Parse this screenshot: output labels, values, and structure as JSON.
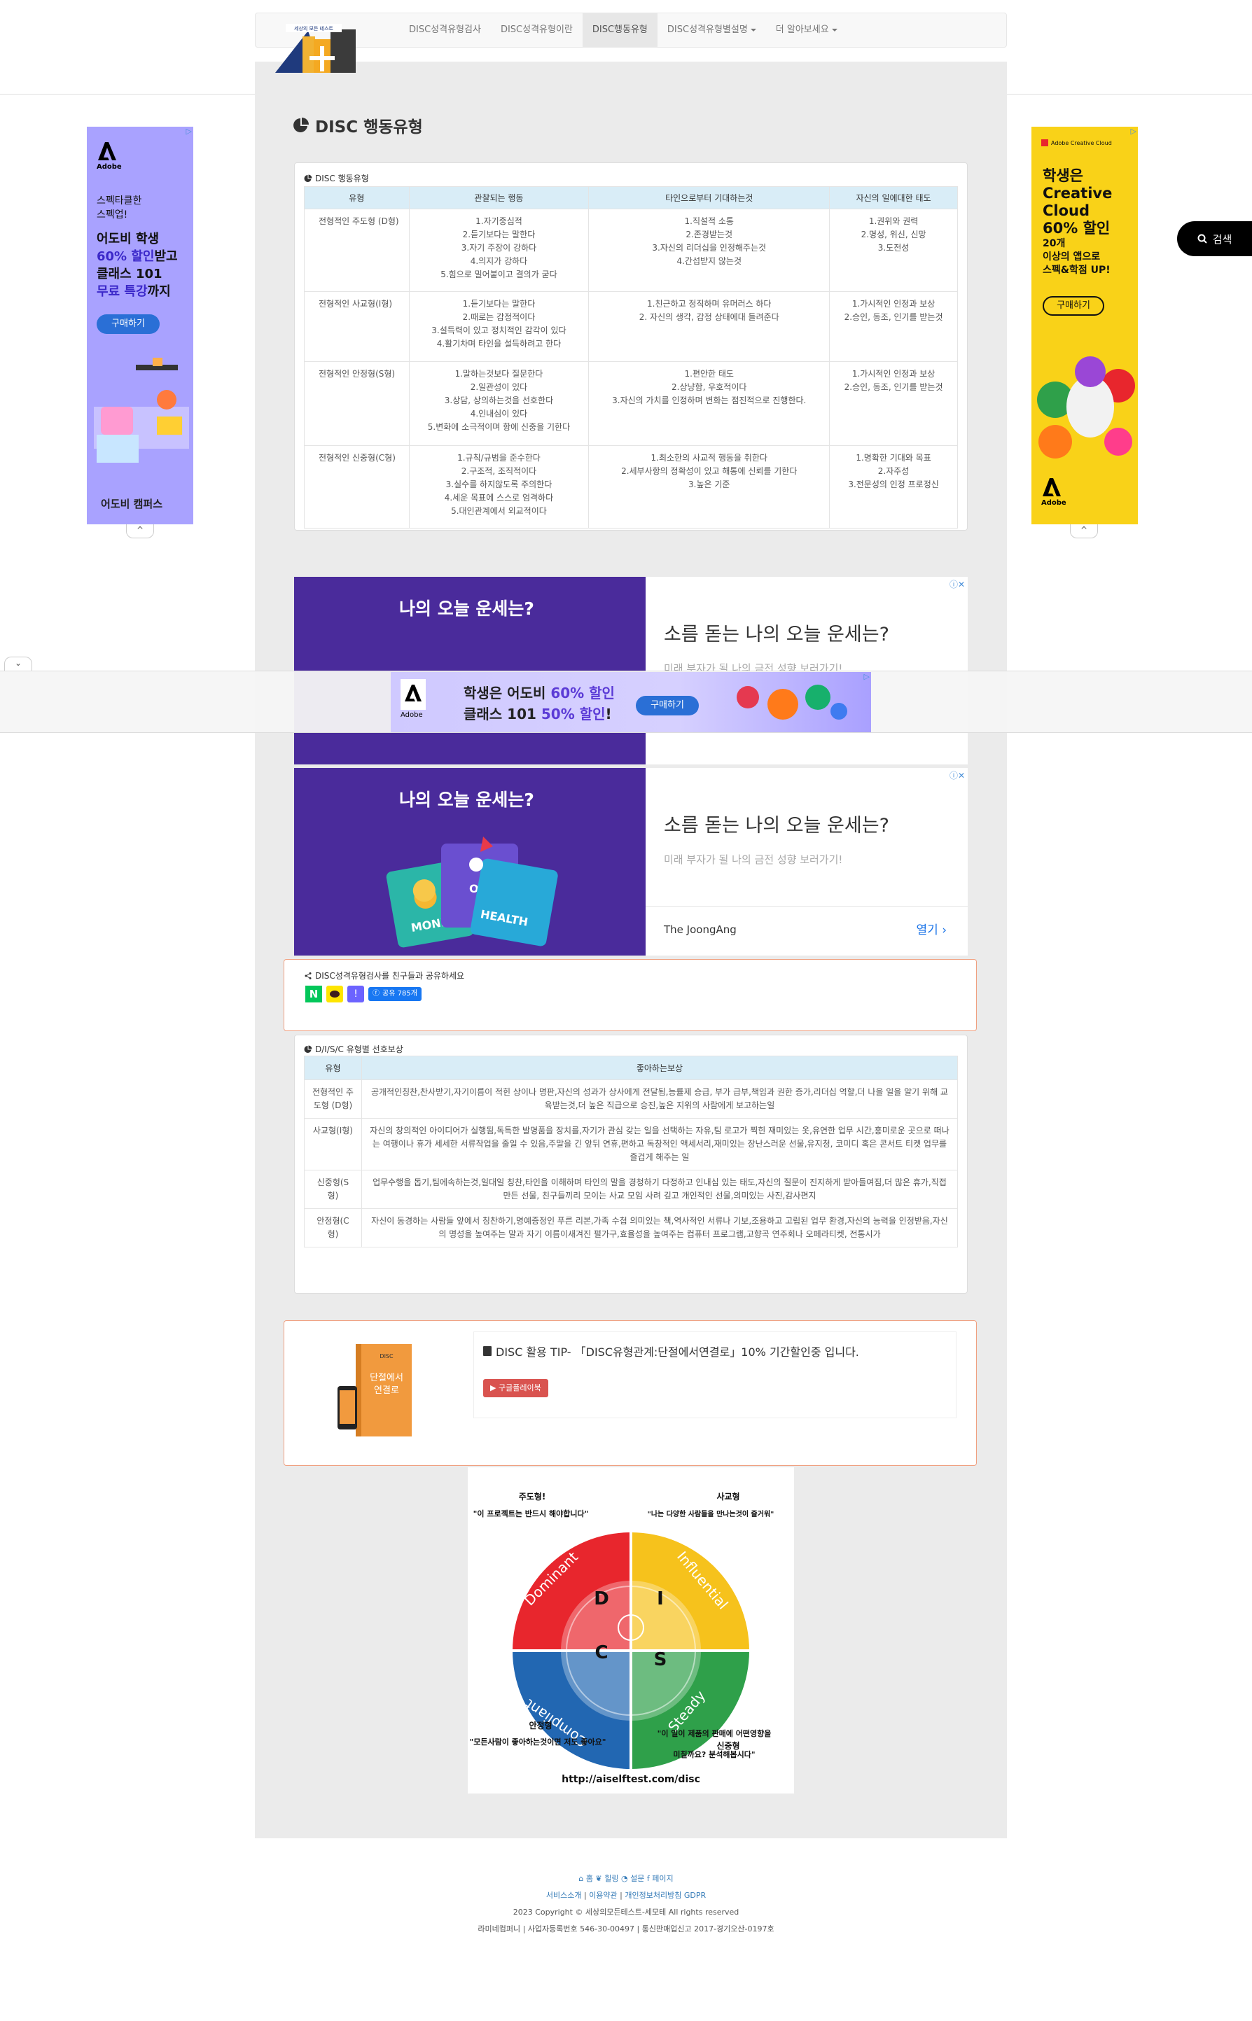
{
  "nav": {
    "logo_text": "세상의 모든 테스트",
    "items": [
      "DISC성격유형검사",
      "DISC성격유형이란",
      "DISC행동유형",
      "DISC성격유형별설명",
      "더 알아보세요"
    ]
  },
  "page": {
    "title": "DISC 행동유형"
  },
  "behavior_table": {
    "caption": "DISC 행동유형",
    "headers": [
      "유형",
      "관찰되는 행동",
      "타인으로부터 기대하는것",
      "자신의 일에대한 태도"
    ],
    "rows": [
      {
        "type": "전형적인 주도형 (D형)",
        "observed": [
          "1.자기중심적",
          "2.듣기보다는 말한다",
          "3.자기 주장이 강하다",
          "4.의지가 강하다",
          "5.힘으로 밀어붙이고 결의가 굳다"
        ],
        "expect": [
          "1.직설적 소통",
          "2.존경받는것",
          "3.자신의 리더십을 인정해주는것",
          "4.간섭받지 않는것"
        ],
        "attitude": [
          "1.권위와 권력",
          "2.명성, 위신, 신망",
          "3.도전성"
        ]
      },
      {
        "type": "전형적인 사교형(I형)",
        "observed": [
          "1.듣기보다는 말한다",
          "2.때로는 감정적이다",
          "3.설득력이 있고 정치적인 감각이 있다",
          "4.활기차며 타인을 설득하려고 한다"
        ],
        "expect": [
          "1.친근하고 정직하며 유머러스 하다",
          "2. 자신의 생각, 감정 상태에대 들려준다"
        ],
        "attitude": [
          "1.가시적인 인정과 보상",
          "2.승인, 동조, 인기를 받는것"
        ]
      },
      {
        "type": "전형적인 안정형(S형)",
        "observed": [
          "1.말하는것보다 질문한다",
          "2.일관성이 있다",
          "3.상담, 상의하는것을 선호한다",
          "4.인내심이 있다",
          "5.변화에 소극적이며 항에 신중을 기한다"
        ],
        "expect": [
          "1.편안한 태도",
          "2.상냥함, 우호적이다",
          "3.자신의 가치를 인정하며 변화는 점진적으로 진행한다."
        ],
        "attitude": [
          "1.가시적인 인정과 보상",
          "2.승인, 동조, 인기를 받는것"
        ]
      },
      {
        "type": "전형적인 신중형(C형)",
        "observed": [
          "1.규칙/규범을 준수한다",
          "2.구조적, 조직적이다",
          "3.실수를 하지않도록 주의한다",
          "4.세운 목표에 스스로 엄격하다",
          "5.대인관계에서 외교적이다"
        ],
        "expect": [
          "1.최소한의 사교적 행동을 취한다",
          "2.세부사항의 정확성이 있고 해통에 신뢰를 기한다",
          "3.높은 기준"
        ],
        "attitude": [
          "1.명확한 기대와 목표",
          "2.자주성",
          "3.전문성의 인정 프로정신"
        ]
      }
    ]
  },
  "ads": {
    "disc_ad_question": "나의 오늘 운세는?",
    "disc_ad_headline": "소름 돋는 나의 오늘 운세는?",
    "disc_ad_sub": "미래 부자가 될 나의 금전 성향 보러가기!",
    "disc_ad_source": "The JoongAng",
    "disc_ad_open": "열기",
    "card_money": "MONEY",
    "card_health": "HEALTH",
    "card_love": "OVE",
    "left_ad": {
      "brand": "Adobe",
      "line1": "스펙타클한",
      "line2": "스펙업!",
      "line3": "어도비 학생",
      "line4a": "60% 할인",
      "line4b": "받고",
      "line5": "클래스 101",
      "line6a": "무료 특강",
      "line6b": "까지",
      "cta": "구매하기",
      "bottom_label": "어도비 캠퍼스"
    },
    "right_ad": {
      "top": "Adobe Creative Cloud",
      "h1": "학생은",
      "h2": "Creative",
      "h3": "Cloud",
      "h4": "60% 할인",
      "s1": "20개",
      "s2": "이상의 앱으로",
      "s3": "스펙&학점 UP!",
      "cta": "구매하기",
      "brand": "Adobe"
    },
    "sticky": {
      "brand": "Adobe",
      "line1a": "학생은 어도비 ",
      "line1b": "60% 할인",
      "line2a": "클래스 101 ",
      "line2b": "50% 할인",
      "line2c": "!",
      "cta": "구매하기"
    }
  },
  "share": {
    "caption": "DISC성격유형검사를 친구들과 공유하세요",
    "fb_label": "공유 785개"
  },
  "reward_table": {
    "caption": "D/I/S/C 유형별 선호보상",
    "headers": [
      "유형",
      "좋아하는보상"
    ],
    "rows": [
      {
        "type": "전형적인 주도형 (D형)",
        "text": "공개적인칭찬,찬사받기,자기이름이 적힌 상이나 명판,자신의 성과가 상사에게 전달됨,능률제 승급, 부가 급부,책임과 권한 증가,리더십 역할,더 나을 일을 알기 위해 교육받는것,더 높은 직급으로 승진,높은 지위의 사람에게 보고하는일"
      },
      {
        "type": "사교형(I형)",
        "text": "자신의 창의적인 아이디어가 실행됨,독특한 발명품을 장치를,자기가 관심 갖는 일을 선택하는 자유,팀 로고가 찍힌 재미있는 옷,유연한 업무 시간,흥미로운 곳으로 떠나는 여행이나 휴가 세세한 서류작업을 줄일 수 있음,주말을 긴 앞뒤 연휴,편하고 독창적인 액세서리,재미있는 장난스러운 선물,유지청, 코미디 혹은 콘서트 티켓 업무를 즐겁게 해주는 일"
      },
      {
        "type": "신중형(S형)",
        "text": "업무수행을 돕기,팀에속하는것,일대일 칭찬,타인을 이해하며 타인의 말을 경청하기 다정하고 인내심 있는 태도,자신의 질문이 진지하게 받아들여짐,더 많은 휴가,직접 만든 선물, 친구들끼리 모이는 사교 모임 사려 깊고 개인적인 선물,의미있는 사진,감사편지"
      },
      {
        "type": "안정형(C형)",
        "text": "자신이 동경하는 사람들 앞에서 칭찬하기,명예증정인 푸른 리본,가족 수첩 의미있는 책,역사적인 서류나 기보,조용하고 고립된 업무 환경,자신의 능력을 인정받음,자신의 명성을 높여주는 말과 자기 이름이새겨진 펄가구,효율성을 높여주는 컴퓨터 프로그램,고향곡 연주회나 오페라티켓, 전통시가"
      }
    ]
  },
  "tip": {
    "text": "DISC 활용 TIP- 「DISC유형관계:단절에서연결로」10% 기간할인중 입니다.",
    "button": "구글플레이북",
    "book_line1": "단절에서",
    "book_line2": "연결로"
  },
  "diagram": {
    "label_d_top": "주도형!",
    "quote_d": "\"이 프로젝트는 반드시 해야합니다\"",
    "label_i_top": "사교형",
    "quote_i": "\"나는 다양한 사람들을 만나는것이 즐거워\"",
    "label_c_bot": "안정형",
    "quote_c": "\"모든사람이 좋아하는것이면 저도 좋아요\"",
    "label_s_bot": "신중형",
    "quote_s1": "\"이 일이 제품의 판매에 어떤영향을",
    "quote_s2": "미칠까요? 분석해봅시다\"",
    "word_d": "Dominant",
    "word_i": "Influential",
    "word_c": "Compliant",
    "word_s": "Steady",
    "letter_d": "D",
    "letter_i": "I",
    "letter_c": "C",
    "letter_s": "S",
    "url": "http://aiselftest.com/disc",
    "colors": {
      "d": "#e8262d",
      "i": "#f6c21c",
      "c": "#2267b2",
      "s": "#2fa04a"
    }
  },
  "footer": {
    "icons_row": [
      "홈",
      "힐링",
      "설문",
      "페이지"
    ],
    "links": [
      "서비스소개",
      "이용약관",
      "개인정보처리방침",
      "GDPR"
    ],
    "copyright": "2023 Copyright © 세상의모든테스트-세모테 All rights reserved",
    "company": "라미네컴퍼니 | 사업자등록번호 546-30-00497 | 통신판매업신고 2017-경기오산-0197호"
  },
  "search": {
    "label": "검색"
  }
}
